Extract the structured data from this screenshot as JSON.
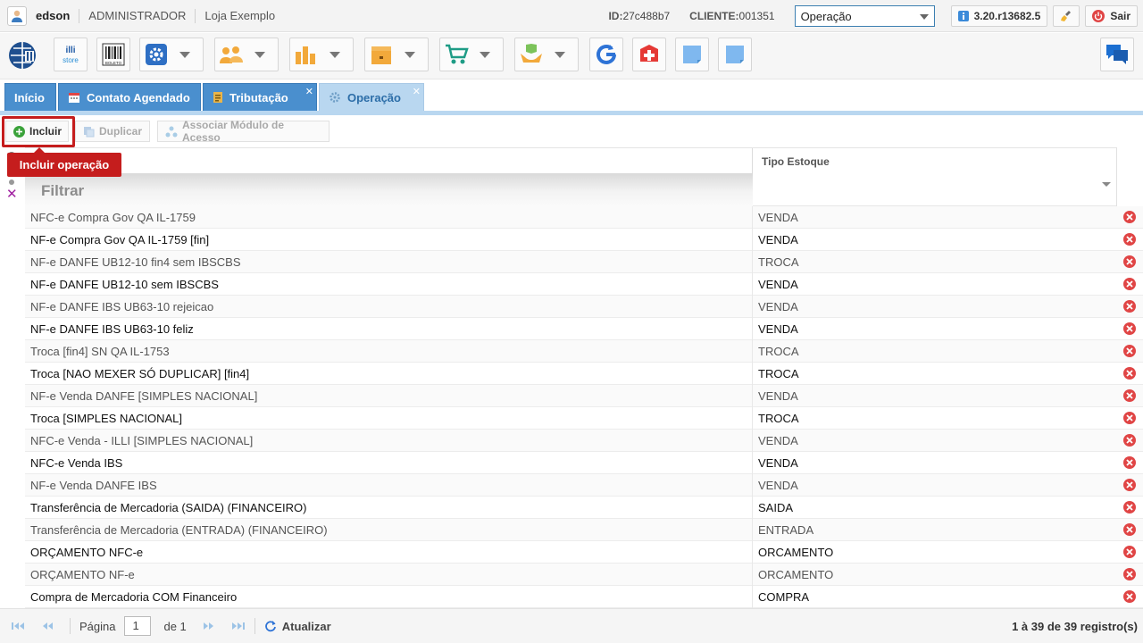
{
  "topbar": {
    "user": "edson",
    "role": "ADMINISTRADOR",
    "store": "Loja Exemplo",
    "id_label": "ID:",
    "id_value": "27c488b7",
    "client_label": "CLIENTE:",
    "client_value": "001351",
    "module_select": "Operação",
    "version": "3.20.r13682.5",
    "logout": "Sair"
  },
  "toolbar": {
    "items": [
      {
        "name": "logo",
        "icon": "brand-logo-icon"
      },
      {
        "name": "illi-store",
        "icon": "illi-store-icon",
        "label": "illi store"
      },
      {
        "name": "boleto",
        "icon": "barcode-icon",
        "label": "BOLETO"
      },
      {
        "name": "settings",
        "icon": "gear-icon"
      },
      {
        "name": "people",
        "icon": "users-icon"
      },
      {
        "name": "reports",
        "icon": "bar-chart-icon"
      },
      {
        "name": "inventory",
        "icon": "box-icon"
      },
      {
        "name": "sales",
        "icon": "cart-icon"
      },
      {
        "name": "services",
        "icon": "hand-box-icon"
      },
      {
        "name": "sync",
        "icon": "google-sync-icon"
      },
      {
        "name": "health",
        "icon": "medical-plus-icon"
      },
      {
        "name": "note1",
        "icon": "note-icon"
      },
      {
        "name": "note2",
        "icon": "note-icon"
      },
      {
        "name": "chat",
        "icon": "chat-icon"
      }
    ]
  },
  "tabs": [
    {
      "label": "Início",
      "closable": false,
      "active": false
    },
    {
      "label": "Contato Agendado",
      "closable": false,
      "active": false,
      "icon": "calendar-icon"
    },
    {
      "label": "Tributação",
      "closable": true,
      "active": false,
      "icon": "tax-icon"
    },
    {
      "label": "Operação",
      "closable": true,
      "active": true,
      "icon": "gear-icon"
    }
  ],
  "actions": {
    "include": "Incluir",
    "duplicate": "Duplicar",
    "associate": "Associar Módulo de Acesso",
    "tooltip": "Incluir operação"
  },
  "grid": {
    "col_stock": "Tipo Estoque",
    "filter_placeholder": "Filtrar",
    "rows": [
      {
        "name": "NFC-e Compra Gov QA IL-1759",
        "stock": "VENDA"
      },
      {
        "name": "NF-e Compra Gov QA IL-1759 [fin]",
        "stock": "VENDA"
      },
      {
        "name": "NF-e DANFE UB12-10 fin4 sem IBSCBS",
        "stock": "TROCA"
      },
      {
        "name": "NF-e DANFE UB12-10 sem IBSCBS",
        "stock": "VENDA"
      },
      {
        "name": "NF-e DANFE IBS UB63-10 rejeicao",
        "stock": "VENDA"
      },
      {
        "name": "NF-e DANFE IBS UB63-10 feliz",
        "stock": "VENDA"
      },
      {
        "name": "Troca [fin4] SN QA IL-1753",
        "stock": "TROCA"
      },
      {
        "name": "Troca [NAO MEXER SÓ DUPLICAR] [fin4]",
        "stock": "TROCA"
      },
      {
        "name": "NF-e Venda DANFE [SIMPLES NACIONAL]",
        "stock": "VENDA"
      },
      {
        "name": "Troca [SIMPLES NACIONAL]",
        "stock": "TROCA"
      },
      {
        "name": "NFC-e Venda - ILLI [SIMPLES NACIONAL]",
        "stock": "VENDA"
      },
      {
        "name": "NFC-e Venda IBS",
        "stock": "VENDA"
      },
      {
        "name": "NF-e Venda DANFE IBS",
        "stock": "VENDA"
      },
      {
        "name": "Transferência de Mercadoria (SAIDA) (FINANCEIRO)",
        "stock": "SAIDA"
      },
      {
        "name": "Transferência de Mercadoria (ENTRADA) (FINANCEIRO)",
        "stock": "ENTRADA"
      },
      {
        "name": "ORÇAMENTO NFC-e",
        "stock": "ORCAMENTO"
      },
      {
        "name": "ORÇAMENTO NF-e",
        "stock": "ORCAMENTO"
      },
      {
        "name": "Compra de Mercadoria COM Financeiro",
        "stock": "COMPRA"
      }
    ]
  },
  "pager": {
    "page_label": "Página",
    "page_value": "1",
    "of_label": "de 1",
    "refresh": "Atualizar",
    "count": "1 à 39 de 39 registro(s)"
  },
  "colors": {
    "tab_blue": "#4a8fce",
    "tab_active": "#b9d7f0",
    "alert_red": "#c51d1d",
    "delete_red": "#e04545"
  }
}
